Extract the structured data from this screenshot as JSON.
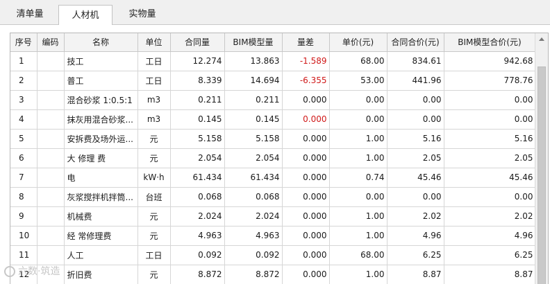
{
  "tabs": [
    {
      "label": "清单量"
    },
    {
      "label": "人材机"
    },
    {
      "label": "实物量"
    }
  ],
  "active_tab": 1,
  "table": {
    "headers": [
      "序号",
      "编码",
      "名称",
      "单位",
      "合同量",
      "BIM模型量",
      "量差",
      "单价(元)",
      "合同合价(元)",
      "BIM模型合价(元)"
    ],
    "rows": [
      [
        "1",
        "",
        "技工",
        "工日",
        "12.274",
        "13.863",
        "-1.589",
        "68.00",
        "834.61",
        "942.68"
      ],
      [
        "2",
        "",
        "普工",
        "工日",
        "8.339",
        "14.694",
        "-6.355",
        "53.00",
        "441.96",
        "778.76"
      ],
      [
        "3",
        "",
        "混合砂浆 1:0.5:1",
        "m3",
        "0.211",
        "0.211",
        "0.000",
        "0.00",
        "0.00",
        "0.00"
      ],
      [
        "4",
        "",
        "抹灰用混合砂浆...",
        "m3",
        "0.145",
        "0.145",
        "0.000",
        "0.00",
        "0.00",
        "0.00"
      ],
      [
        "5",
        "",
        "安拆费及场外运...",
        "元",
        "5.158",
        "5.158",
        "0.000",
        "1.00",
        "5.16",
        "5.16"
      ],
      [
        "6",
        "",
        "大 修理 费",
        "元",
        "2.054",
        "2.054",
        "0.000",
        "1.00",
        "2.05",
        "2.05"
      ],
      [
        "7",
        "",
        "电",
        "kW·h",
        "61.434",
        "61.434",
        "0.000",
        "0.74",
        "45.46",
        "45.46"
      ],
      [
        "8",
        "",
        "灰浆搅拌机拌筒...",
        "台班",
        "0.068",
        "0.068",
        "0.000",
        "0.00",
        "0.00",
        "0.00"
      ],
      [
        "9",
        "",
        "机械费",
        "元",
        "2.024",
        "2.024",
        "0.000",
        "1.00",
        "2.02",
        "2.02"
      ],
      [
        "10",
        "",
        "经 常修理费",
        "元",
        "4.963",
        "4.963",
        "0.000",
        "1.00",
        "4.96",
        "4.96"
      ],
      [
        "11",
        "",
        "人工",
        "工日",
        "0.092",
        "0.092",
        "0.000",
        "68.00",
        "6.25",
        "6.25"
      ],
      [
        "12",
        "",
        "折旧费",
        "元",
        "8.872",
        "8.872",
        "0.000",
        "1.00",
        "8.87",
        "8.87"
      ]
    ],
    "highlight_red": [
      [
        0,
        6
      ],
      [
        1,
        6
      ],
      [
        3,
        6
      ]
    ]
  },
  "watermark": {
    "text": "六数·筑造"
  },
  "colors": {
    "negative": "#d01818",
    "tab_bg": "#f0f0f0",
    "header_bg": "#f3f3f3"
  }
}
